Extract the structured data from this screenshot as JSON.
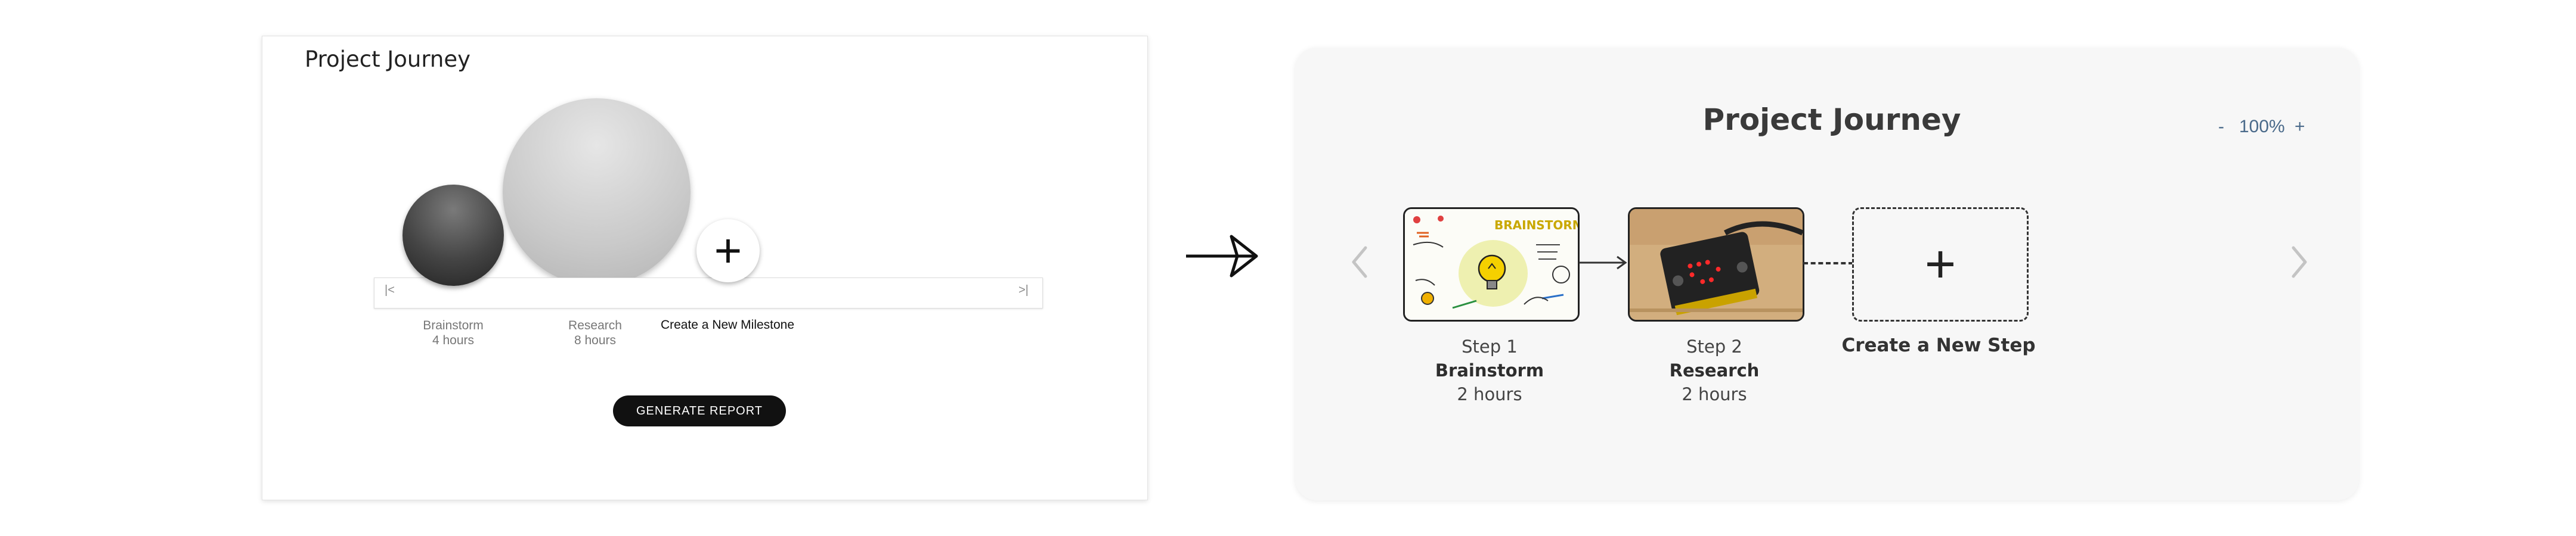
{
  "old_design": {
    "title": "Project Journey",
    "milestones": [
      {
        "name": "Brainstorm",
        "duration": "4 hours"
      },
      {
        "name": "Research",
        "duration": "8 hours"
      }
    ],
    "add_symbol": "+",
    "new_milestone_label": "Create a New Milestone",
    "track_prev_icon": "|<",
    "track_next_icon": ">|",
    "report_button": "GENERATE REPORT"
  },
  "transition_icon": "arrow-right-icon",
  "new_design": {
    "title": "Project Journey",
    "zoom": {
      "out_label": "-",
      "level": "100%",
      "in_label": "+"
    },
    "nav": {
      "prev_icon": "chevron-left-icon",
      "next_icon": "chevron-right-icon"
    },
    "steps": [
      {
        "step_label": "Step 1",
        "name": "Brainstorm",
        "duration": "2 hours",
        "thumbnail_text": "BRAINSTORMING"
      },
      {
        "step_label": "Step 2",
        "name": "Research",
        "duration": "2 hours"
      }
    ],
    "add_symbol": "+",
    "new_step_label": "Create a New Step"
  }
}
